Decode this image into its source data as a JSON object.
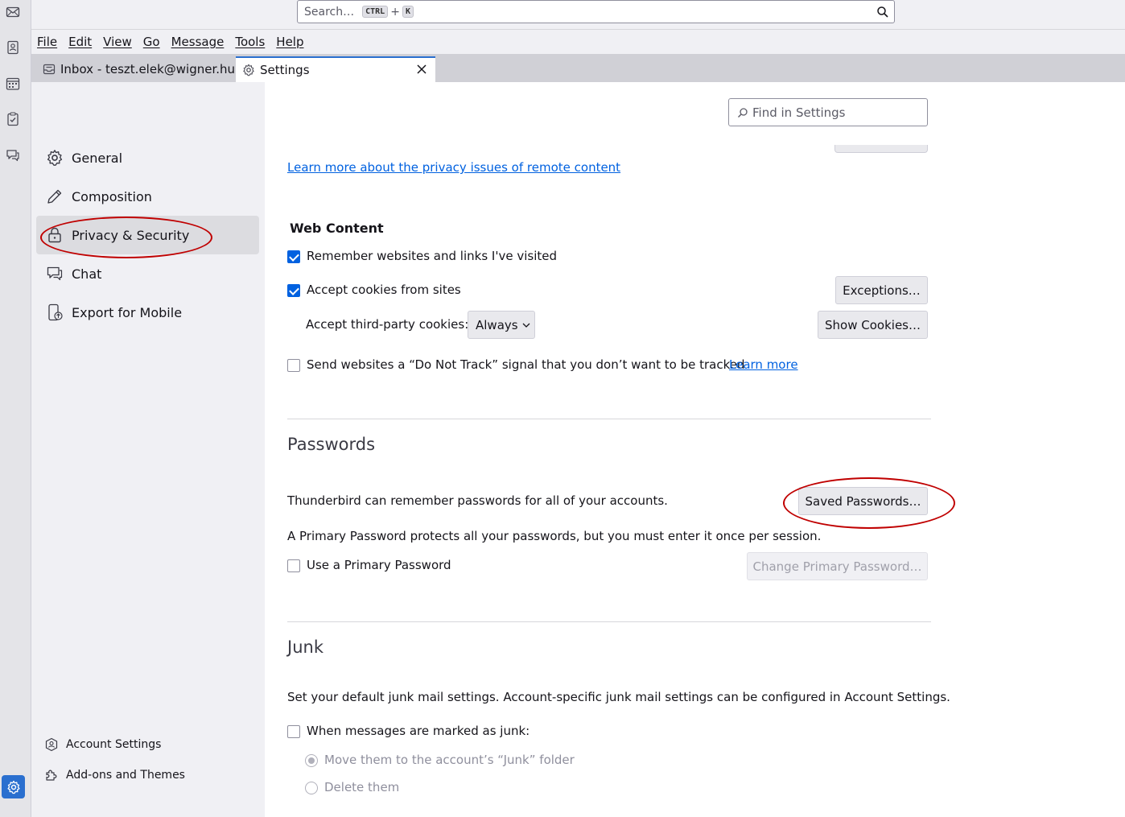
{
  "spaces": {
    "items": [
      "mail-icon",
      "address-book-icon",
      "calendar-icon",
      "tasks-icon",
      "chat-icon"
    ],
    "settings_icon": "gear-icon"
  },
  "search": {
    "placeholder": "Search…",
    "shortcut_key1": "CTRL",
    "shortcut_plus": "+",
    "shortcut_key2": "K"
  },
  "menubar": {
    "items": [
      "File",
      "Edit",
      "View",
      "Go",
      "Message",
      "Tools",
      "Help"
    ]
  },
  "tabs": [
    {
      "label": "Inbox - teszt.elek@wigner.hu",
      "icon": "inbox-icon"
    },
    {
      "label": "Settings",
      "icon": "gear-icon",
      "active": true
    }
  ],
  "nav": {
    "items": [
      {
        "label": "General",
        "icon": "gear-icon"
      },
      {
        "label": "Composition",
        "icon": "pencil-icon"
      },
      {
        "label": "Privacy & Security",
        "icon": "lock-icon",
        "active": true
      },
      {
        "label": "Chat",
        "icon": "chat-icon"
      },
      {
        "label": "Export for Mobile",
        "icon": "mobile-export-icon"
      }
    ],
    "footer": [
      {
        "label": "Account Settings",
        "icon": "account-icon"
      },
      {
        "label": "Add-ons and Themes",
        "icon": "puzzle-icon"
      }
    ]
  },
  "find": {
    "placeholder": "Find in Settings"
  },
  "remote_content": {
    "learn_more": "Learn more about the privacy issues of remote content"
  },
  "web_content": {
    "heading": "Web Content",
    "remember_sites": {
      "label": "Remember websites and links I've visited",
      "checked": true
    },
    "accept_cookies": {
      "label": "Accept cookies from sites",
      "checked": true
    },
    "exceptions_button": "Exceptions…",
    "third_party_label": "Accept third-party cookies:",
    "third_party_value": "Always",
    "show_cookies_button": "Show Cookies…",
    "dnt": {
      "label": "Send websites a “Do Not Track” signal that you don’t want to be tracked",
      "checked": false
    },
    "dnt_learn_more": "Learn more"
  },
  "passwords": {
    "heading": "Passwords",
    "description": "Thunderbird can remember passwords for all of your accounts.",
    "saved_button": "Saved Passwords…",
    "primary_desc": "A Primary Password protects all your passwords, but you must enter it once per session.",
    "use_primary": {
      "label": "Use a Primary Password",
      "checked": false
    },
    "change_primary_button": "Change Primary Password…"
  },
  "junk": {
    "heading": "Junk",
    "description": "Set your default junk mail settings. Account-specific junk mail settings can be configured in Account Settings.",
    "when_marked": {
      "label": "When messages are marked as junk:",
      "checked": false
    },
    "move_option": {
      "label": "Move them to the account’s “Junk” folder",
      "selected": true
    },
    "delete_option": {
      "label": "Delete them",
      "selected": false
    }
  },
  "colors": {
    "accent": "#0061e0",
    "annotation": "#c00000"
  }
}
